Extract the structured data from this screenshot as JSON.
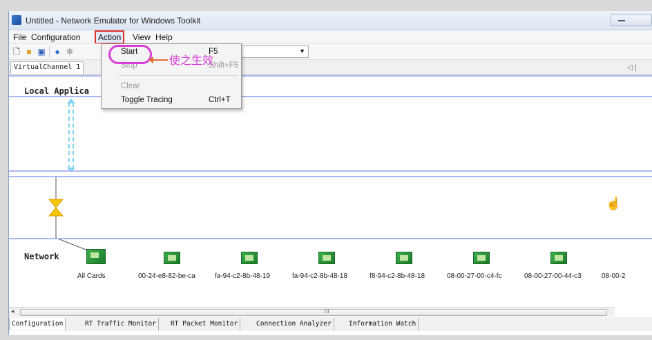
{
  "window": {
    "title": "Untitled - Network Emulator for Windows Toolkit"
  },
  "menubar": {
    "items": [
      "File",
      "Configuration",
      "Action",
      "View",
      "Help"
    ]
  },
  "toolbar": {
    "icons": [
      "new-file-icon",
      "open-folder-icon",
      "save-icon",
      "globe-icon",
      "settings-icon"
    ]
  },
  "channel": {
    "tab_label": "VirtualChannel 1",
    "nav": "◁ |"
  },
  "action_menu": {
    "items": [
      {
        "label": "Start",
        "shortcut": "F5",
        "enabled": true
      },
      {
        "label": "Stop",
        "shortcut": "Shift+F5",
        "enabled": false
      },
      {
        "label": "Clear",
        "shortcut": "",
        "enabled": false
      },
      {
        "label": "Toggle Tracing",
        "shortcut": "Ctrl+T",
        "enabled": true
      }
    ],
    "annotation": "使之生效"
  },
  "canvas": {
    "local_label": "Local Applica",
    "network_label": "Network"
  },
  "cards": [
    {
      "label": "All Cards"
    },
    {
      "label": "00-24-e8-82-be-ca"
    },
    {
      "label": "fa-94-c2-8b-48-19"
    },
    {
      "label": "fa-94-c2-8b-48-18"
    },
    {
      "label": "f8-94-c2-8b-48-18"
    },
    {
      "label": "08-00-27-00-c4-fc"
    },
    {
      "label": "08-00-27-00-44-c3"
    },
    {
      "label": "08-00-2"
    }
  ],
  "scrollbar": {
    "left_arrow": "◂",
    "grip": "III"
  },
  "bottom_tabs": [
    "Configuration",
    "RT Traffic Monitor",
    "RT Packet Monitor",
    "Connection Analyzer",
    "Information Watch"
  ],
  "colors": {
    "lane": "#a9b9ee",
    "link": "#7fd3f0",
    "card": "#2f9a3d",
    "highlight": "#e0302a",
    "annotation": "#d83ed6"
  }
}
